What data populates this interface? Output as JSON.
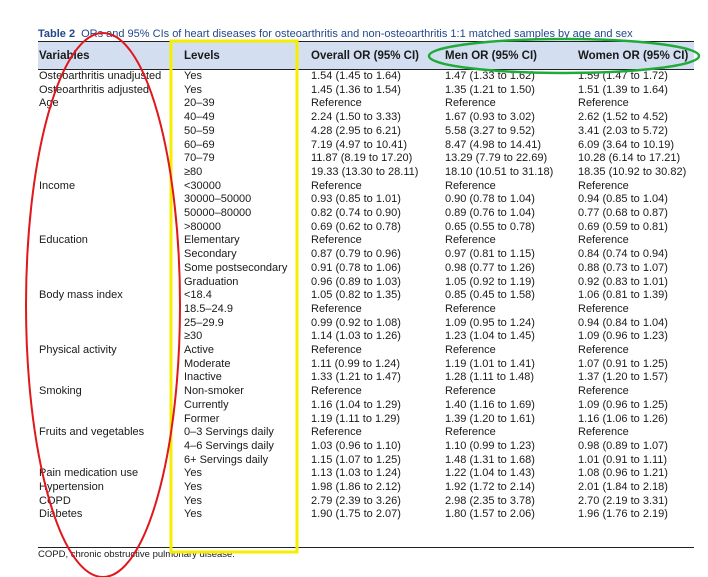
{
  "caption": {
    "table_number": "Table 2",
    "text": "ORs and 95% CIs of heart diseases for osteoarthritis and non-osteoarthritis 1:1 matched samples by age and sex"
  },
  "headers": {
    "variables": "Variables",
    "levels": "Levels",
    "overall": "Overall OR (95% CI)",
    "men": "Men OR (95% CI)",
    "women": "Women OR (95% CI)"
  },
  "rows": [
    {
      "variable": "Osteoarthritis unadjusted",
      "level": "Yes",
      "overall": "1.54 (1.45 to 1.64)",
      "men": "1.47 (1.33 to 1.62)",
      "women": "1.59 (1.47 to 1.72)"
    },
    {
      "variable": "Osteoarthritis adjusted",
      "level": "Yes",
      "overall": "1.45 (1.36 to 1.54)",
      "men": "1.35 (1.21 to 1.50)",
      "women": "1.51 (1.39 to 1.64)"
    },
    {
      "variable": "Age",
      "level": "20–39",
      "overall": "Reference",
      "men": "Reference",
      "women": "Reference"
    },
    {
      "variable": "",
      "level": "40–49",
      "overall": "2.24 (1.50 to 3.33)",
      "men": "1.67 (0.93 to 3.02)",
      "women": "2.62 (1.52 to 4.52)"
    },
    {
      "variable": "",
      "level": "50–59",
      "overall": "4.28 (2.95 to 6.21)",
      "men": "5.58 (3.27 to 9.52)",
      "women": "3.41 (2.03 to 5.72)"
    },
    {
      "variable": "",
      "level": "60–69",
      "overall": "7.19 (4.97 to 10.41)",
      "men": "8.47 (4.98 to 14.41)",
      "women": "6.09 (3.64 to 10.19)"
    },
    {
      "variable": "",
      "level": "70–79",
      "overall": "11.87 (8.19 to 17.20)",
      "men": "13.29 (7.79 to 22.69)",
      "women": "10.28 (6.14 to 17.21)"
    },
    {
      "variable": "",
      "level": "≥80",
      "overall": "19.33 (13.30 to 28.11)",
      "men": "18.10 (10.51 to 31.18)",
      "women": "18.35 (10.92 to 30.82)"
    },
    {
      "variable": "Income",
      "level": "<30000",
      "overall": "Reference",
      "men": "Reference",
      "women": "Reference"
    },
    {
      "variable": "",
      "level": "30000–50000",
      "overall": "0.93 (0.85 to 1.01)",
      "men": "0.90 (0.78 to 1.04)",
      "women": "0.94 (0.85 to 1.04)"
    },
    {
      "variable": "",
      "level": "50000–80000",
      "overall": "0.82 (0.74 to 0.90)",
      "men": "0.89 (0.76 to 1.04)",
      "women": "0.77 (0.68 to 0.87)"
    },
    {
      "variable": "",
      "level": ">80000",
      "overall": "0.69 (0.62 to 0.78)",
      "men": "0.65 (0.55 to 0.78)",
      "women": "0.69 (0.59 to 0.81)"
    },
    {
      "variable": "Education",
      "level": "Elementary",
      "overall": "Reference",
      "men": "Reference",
      "women": "Reference"
    },
    {
      "variable": "",
      "level": "Secondary",
      "overall": "0.87 (0.79 to 0.96)",
      "men": "0.97 (0.81 to 1.15)",
      "women": "0.84 (0.74 to 0.94)"
    },
    {
      "variable": "",
      "level": "Some postsecondary",
      "overall": "0.91 (0.78 to 1.06)",
      "men": "0.98 (0.77 to 1.26)",
      "women": "0.88 (0.73 to 1.07)"
    },
    {
      "variable": "",
      "level": "Graduation",
      "overall": "0.96 (0.89 to 1.03)",
      "men": "1.05 (0.92 to 1.19)",
      "women": "0.92 (0.83 to 1.01)"
    },
    {
      "variable": "Body mass index",
      "level": "<18.4",
      "overall": "1.05 (0.82 to 1.35)",
      "men": "0.85 (0.45 to 1.58)",
      "women": "1.06 (0.81 to 1.39)"
    },
    {
      "variable": "",
      "level": "18.5–24.9",
      "overall": "Reference",
      "men": "Reference",
      "women": "Reference"
    },
    {
      "variable": "",
      "level": "25–29.9",
      "overall": "0.99 (0.92 to 1.08)",
      "men": "1.09 (0.95 to 1.24)",
      "women": "0.94 (0.84 to 1.04)"
    },
    {
      "variable": "",
      "level": "≥30",
      "overall": "1.14 (1.03 to 1.26)",
      "men": "1.23 (1.04 to 1.45)",
      "women": "1.09 (0.96 to 1.23)"
    },
    {
      "variable": "Physical activity",
      "level": "Active",
      "overall": "Reference",
      "men": "Reference",
      "women": "Reference"
    },
    {
      "variable": "",
      "level": "Moderate",
      "overall": "1.11 (0.99 to 1.24)",
      "men": "1.19 (1.01 to 1.41)",
      "women": "1.07 (0.91 to 1.25)"
    },
    {
      "variable": "",
      "level": "Inactive",
      "overall": "1.33 (1.21 to 1.47)",
      "men": "1.28 (1.11 to 1.48)",
      "women": "1.37 (1.20 to 1.57)"
    },
    {
      "variable": "Smoking",
      "level": "Non-smoker",
      "overall": "Reference",
      "men": "Reference",
      "women": "Reference"
    },
    {
      "variable": "",
      "level": "Currently",
      "overall": "1.16 (1.04 to 1.29)",
      "men": "1.40 (1.16 to 1.69)",
      "women": "1.09 (0.96 to 1.25)"
    },
    {
      "variable": "",
      "level": "Former",
      "overall": "1.19 (1.11 to 1.29)",
      "men": "1.39 (1.20 to 1.61)",
      "women": "1.16 (1.06 to 1.26)"
    },
    {
      "variable": "Fruits and vegetables",
      "level": "0–3 Servings daily",
      "overall": "Reference",
      "men": "Reference",
      "women": "Reference"
    },
    {
      "variable": "",
      "level": "4–6 Servings daily",
      "overall": "1.03 (0.96 to 1.10)",
      "men": "1.10 (0.99 to 1.23)",
      "women": "0.98 (0.89 to 1.07)"
    },
    {
      "variable": "",
      "level": "6+ Servings daily",
      "overall": "1.15 (1.07 to 1.25)",
      "men": "1.48 (1.31 to 1.68)",
      "women": "1.01 (0.91 to 1.11)"
    },
    {
      "variable": "Pain medication use",
      "level": "Yes",
      "overall": "1.13 (1.03 to 1.24)",
      "men": "1.22 (1.04 to 1.43)",
      "women": "1.08 (0.96 to 1.21)"
    },
    {
      "variable": "Hypertension",
      "level": "Yes",
      "overall": "1.98 (1.86 to 2.12)",
      "men": "1.92 (1.72 to 2.14)",
      "women": "2.01 (1.84 to 2.18)"
    },
    {
      "variable": "COPD",
      "level": "Yes",
      "overall": "2.79 (2.39 to 3.26)",
      "men": "2.98 (2.35 to 3.78)",
      "women": "2.70 (2.19 to 3.31)"
    },
    {
      "variable": "Diabetes",
      "level": "Yes",
      "overall": "1.90 (1.75 to 2.07)",
      "men": "1.80 (1.57 to 2.06)",
      "women": "1.96 (1.76 to 2.19)"
    }
  ],
  "footnote": "COPD, chronic obstructive pulmonary disease.",
  "colors": {
    "caption_text": "#23488a",
    "header_band": "#d3dff1",
    "annotation_red": "#e0181c",
    "annotation_yellow": "#f5ee00",
    "annotation_green": "#1faa3a"
  }
}
